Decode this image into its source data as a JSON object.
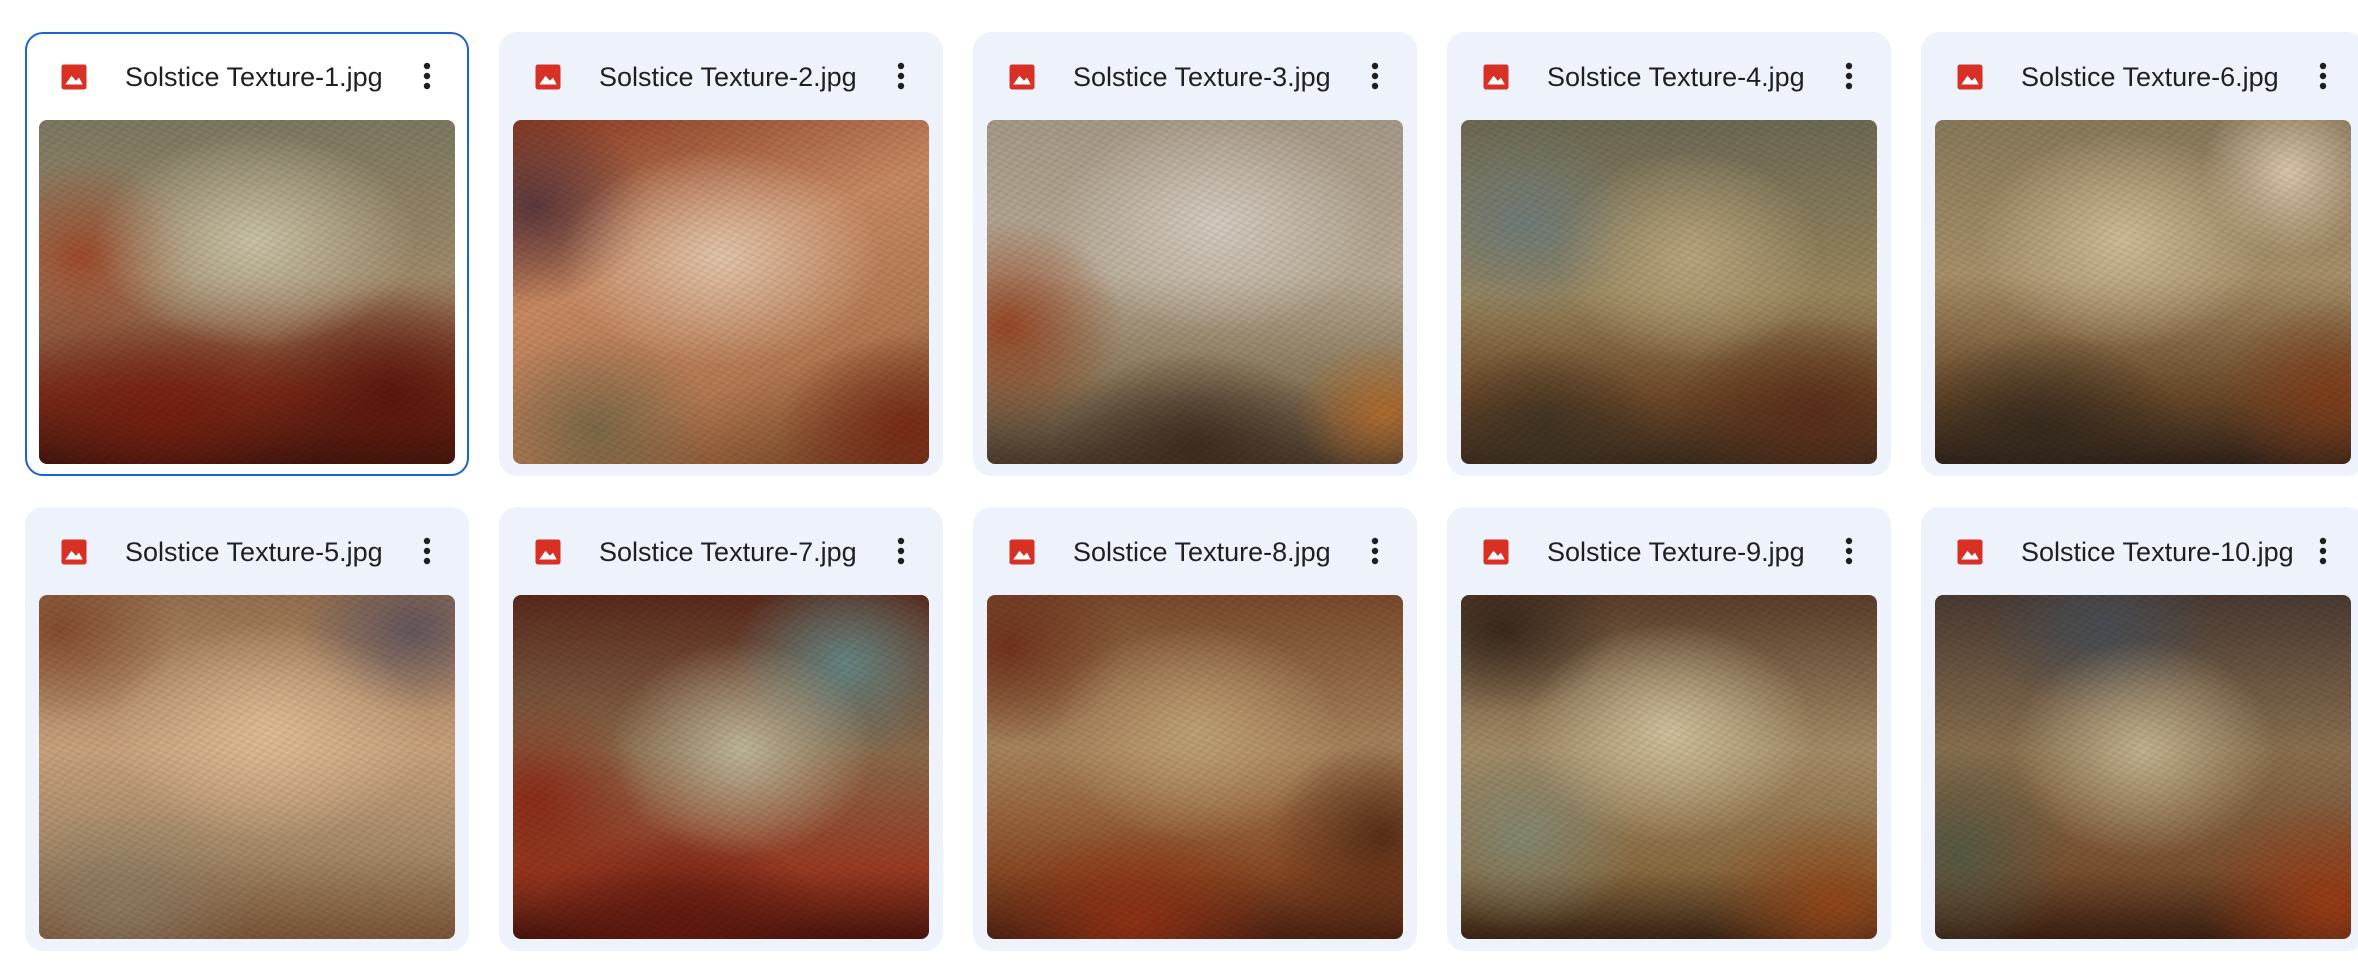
{
  "colors": {
    "card_bg": "#eef3fb",
    "selected_border": "#1a62d8",
    "image_icon": "#d93025",
    "text": "#1f1f1f"
  },
  "files": [
    {
      "name": "Solstice Texture-1.jpg",
      "selected": true,
      "icon": "image-file-icon"
    },
    {
      "name": "Solstice Texture-2.jpg",
      "selected": false,
      "icon": "image-file-icon"
    },
    {
      "name": "Solstice Texture-3.jpg",
      "selected": false,
      "icon": "image-file-icon"
    },
    {
      "name": "Solstice Texture-4.jpg",
      "selected": false,
      "icon": "image-file-icon"
    },
    {
      "name": "Solstice Texture-6.jpg",
      "selected": false,
      "icon": "image-file-icon"
    },
    {
      "name": "Solstice Texture-5.jpg",
      "selected": false,
      "icon": "image-file-icon"
    },
    {
      "name": "Solstice Texture-7.jpg",
      "selected": false,
      "icon": "image-file-icon"
    },
    {
      "name": "Solstice Texture-8.jpg",
      "selected": false,
      "icon": "image-file-icon"
    },
    {
      "name": "Solstice Texture-9.jpg",
      "selected": false,
      "icon": "image-file-icon"
    },
    {
      "name": "Solstice Texture-10.jpg",
      "selected": false,
      "icon": "image-file-icon"
    }
  ]
}
